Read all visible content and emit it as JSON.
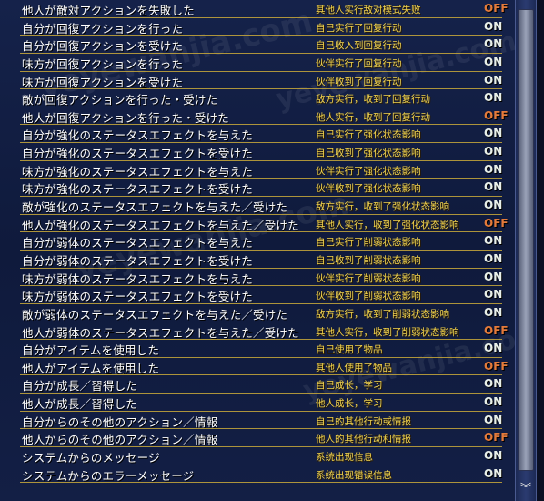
{
  "rows": [
    {
      "jp": "他人が敵対アクションを失敗した",
      "zh": "其他人实行敌对模式失败",
      "status": "OFF"
    },
    {
      "jp": "自分が回復アクションを行った",
      "zh": "自己实行了回复行动",
      "status": "ON"
    },
    {
      "jp": "自分が回復アクションを受けた",
      "zh": "自己收入到回复行动",
      "status": "ON"
    },
    {
      "jp": "味方が回復アクションを行った",
      "zh": "伙伴实行了回复行动",
      "status": "ON"
    },
    {
      "jp": "味方が回復アクションを受けた",
      "zh": "伙伴收到了回复行动",
      "status": "ON"
    },
    {
      "jp": "敵が回復アクションを行った・受けた",
      "zh": "敌方实行，收到了回复行动",
      "status": "ON"
    },
    {
      "jp": "他人が回復アクションを行った・受けた",
      "zh": "他人实行，收到了回复行动",
      "status": "OFF"
    },
    {
      "jp": "自分が強化のステータスエフェクトを与えた",
      "zh": "自己实行了强化状态影响",
      "status": "ON"
    },
    {
      "jp": "自分が強化のステータスエフェクトを受けた",
      "zh": "自己收到了强化状态影响",
      "status": "ON"
    },
    {
      "jp": "味方が強化のステータスエフェクトを与えた",
      "zh": "伙伴实行了强化状态影响",
      "status": "ON"
    },
    {
      "jp": "味方が強化のステータスエフェクトを受けた",
      "zh": "伙伴收到了强化状态影响",
      "status": "ON"
    },
    {
      "jp": "敵が強化のステータスエフェクトを与えた／受けた",
      "zh": "敌方实行，收到了强化状态影响",
      "status": "ON"
    },
    {
      "jp": "他人が強化のステータスエフェクトを与えた／受けた",
      "zh": "其他人实行，收到了强化状态影响",
      "status": "OFF"
    },
    {
      "jp": "自分が弱体のステータスエフェクトを与えた",
      "zh": "自己实行了削弱状态影响",
      "status": "ON"
    },
    {
      "jp": "自分が弱体のステータスエフェクトを受けた",
      "zh": "自己收到了削弱状态影响",
      "status": "ON"
    },
    {
      "jp": "味方が弱体のステータスエフェクトを与えた",
      "zh": "伙伴实行了削弱状态影响",
      "status": "ON"
    },
    {
      "jp": "味方が弱体のステータスエフェクトを受けた",
      "zh": "伙伴收到了削弱状态影响",
      "status": "ON"
    },
    {
      "jp": "敵が弱体のステータスエフェクトを与えた／受けた",
      "zh": "敌方实行，收到了削弱状态影响",
      "status": "ON"
    },
    {
      "jp": "他人が弱体のステータスエフェクトを与えた／受けた",
      "zh": "其他人实行，收到了削弱状态影响",
      "status": "OFF"
    },
    {
      "jp": "自分がアイテムを使用した",
      "zh": "自己使用了物品",
      "status": "ON"
    },
    {
      "jp": "他人がアイテムを使用した",
      "zh": "其他人使用了物品",
      "status": "OFF"
    },
    {
      "jp": "自分が成長／習得した",
      "zh": "自己成长，学习",
      "status": "ON"
    },
    {
      "jp": "他人が成長／習得した",
      "zh": "他人成长，学习",
      "status": "ON"
    },
    {
      "jp": "自分からのその他のアクション／情報",
      "zh": "自己的其他行动或情报",
      "status": "ON"
    },
    {
      "jp": "他人からのその他のアクション／情報",
      "zh": "他人的其他行动和情报",
      "status": "OFF"
    },
    {
      "jp": "システムからのメッセージ",
      "zh": "系统出现信息",
      "status": "ON"
    },
    {
      "jp": "システムからのエラーメッセージ",
      "zh": "系统出现错误信息",
      "status": "ON"
    }
  ],
  "colors": {
    "on": "#e8efe9",
    "off": "#e47a3a",
    "translation": "#f2d34a",
    "separator": "#c9a93a"
  },
  "scrollbar": {
    "down_icon": "chevron-down-double-icon",
    "down_glyph": "︾"
  },
  "watermark": {
    "text": "yeyewanjia.com"
  }
}
